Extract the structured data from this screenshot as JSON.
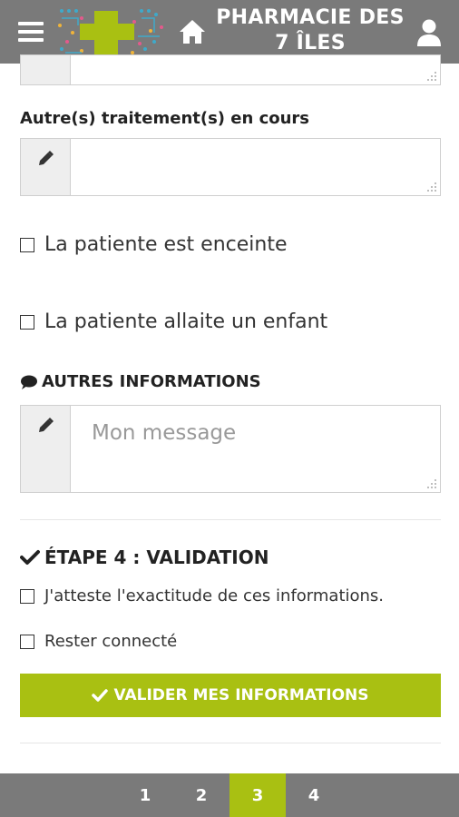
{
  "header": {
    "title_line1": "PHARMACIE DES",
    "title_line2": "7 ÎLES"
  },
  "form": {
    "other_treatments_label": "Autre(s) traitement(s) en cours",
    "other_treatments_value": "",
    "checkbox_pregnant": "La patiente est enceinte",
    "checkbox_breastfeeding": "La patiente allaite un enfant",
    "other_info_title": "AUTRES INFORMATIONS",
    "message_placeholder": "Mon message",
    "step4_title": "ÉTAPE 4 : VALIDATION",
    "checkbox_attest": "J'atteste l'exactitude de ces informations.",
    "checkbox_stay_connected": "Rester connecté",
    "submit_label": "VALIDER MES INFORMATIONS"
  },
  "pagination": {
    "pages": [
      "1",
      "2",
      "3",
      "4"
    ],
    "active": "3"
  },
  "colors": {
    "header_bg": "#7a7a7a",
    "accent": "#a9c012"
  },
  "icons": [
    "menu-icon",
    "logo",
    "home-icon",
    "user-icon",
    "pencil-icon",
    "chat-bubble-icon",
    "checkmark-icon",
    "resize-grip-icon"
  ]
}
